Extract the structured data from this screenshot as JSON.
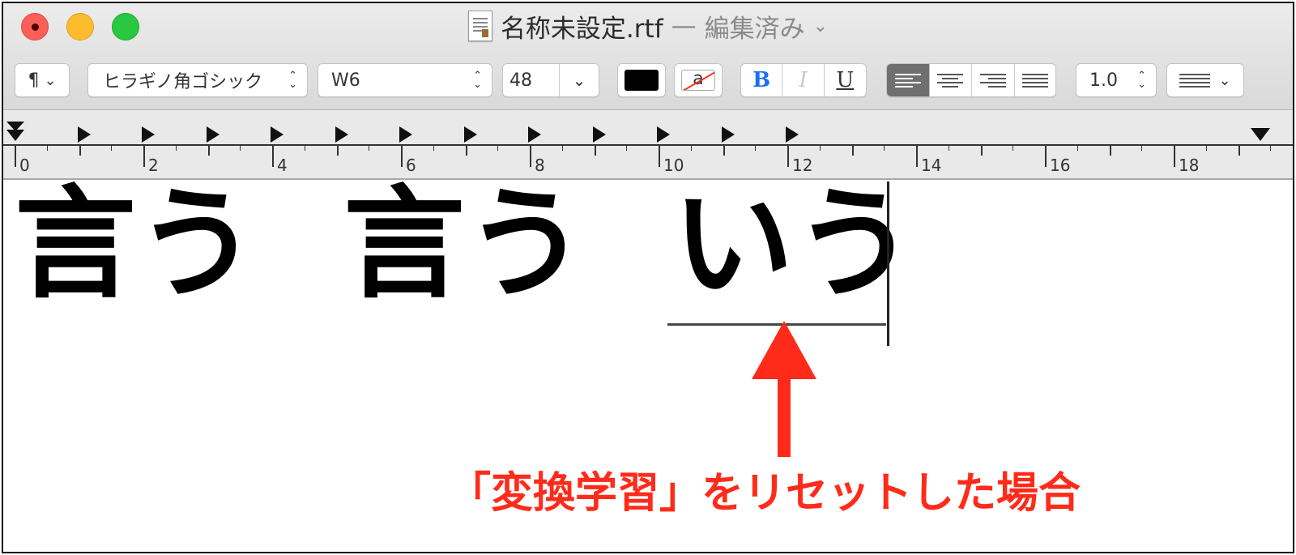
{
  "window": {
    "filename": "名称未設定.rtf",
    "separator": "—",
    "status": "編集済み",
    "title_chevron": "⌄"
  },
  "toolbar": {
    "paragraph_label": "¶",
    "paragraph_chevron": "⌄",
    "font_family": "ヒラギノ角ゴシック",
    "font_weight": "W6",
    "font_size": "48",
    "font_size_chevron": "⌄",
    "text_color": "#000000",
    "bg_color_glyph": "a",
    "bold_label": "B",
    "italic_label": "I",
    "underline_label": "U",
    "line_spacing": "1.0",
    "list_chevron": "⌄",
    "bold_color": "#1a6ff2"
  },
  "ruler": {
    "labels": [
      "0",
      "2",
      "4",
      "6",
      "8",
      "10",
      "12",
      "14",
      "16",
      "18"
    ]
  },
  "document": {
    "word1": "言う",
    "word2": "言う",
    "word3": "いう"
  },
  "annotation": {
    "text": "「変換学習」をリセットした場合",
    "color": "#ff2b1a"
  }
}
